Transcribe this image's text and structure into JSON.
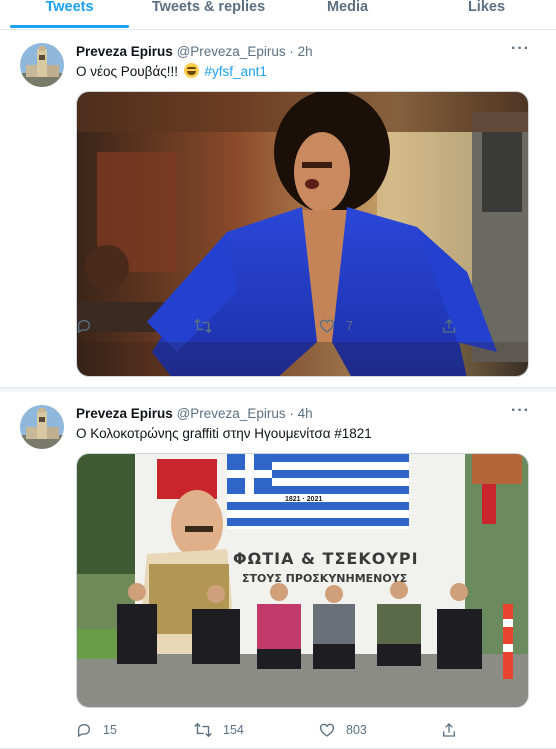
{
  "tabs": [
    {
      "label": "Tweets",
      "active": true
    },
    {
      "label": "Tweets & replies",
      "active": false
    },
    {
      "label": "Media",
      "active": false
    },
    {
      "label": "Likes",
      "active": false
    }
  ],
  "tweets": [
    {
      "name": "Preveza Epirus",
      "handle": "@Preveza_Epirus",
      "dot": "·",
      "time": "2h",
      "text_before": "Ο νέος Ρουβάς!!!",
      "hashtag": "#yfsf_ant1",
      "more": "···",
      "replies": "",
      "retweets": "",
      "likes": "7"
    },
    {
      "name": "Preveza Epirus",
      "handle": "@Preveza_Epirus",
      "dot": "·",
      "time": "4h",
      "text_before": "Ο Κολοκοτρώνης graffiti στην Ηγουμενίτσα #1821",
      "hashtag": "",
      "more": "···",
      "replies": "15",
      "retweets": "154",
      "likes": "803",
      "mural_years": "1821 · 2021",
      "mural_text_1": "ΦΩΤΙΑ & ΤΣΕΚΟΥΡΙ",
      "mural_text_2": "ΣΤΟΥΣ ΠΡΟΣΚΥΝΗΜΕΝΟΥΣ"
    }
  ],
  "icons": {
    "reply": "reply-icon",
    "retweet": "retweet-icon",
    "like": "heart-icon",
    "share": "share-icon",
    "more": "more-icon",
    "emoji": "rolling-on-floor-laughing-emoji"
  },
  "colors": {
    "accent": "#1da1f2",
    "secondary_text": "#5b7083",
    "border": "#e1e8ed"
  }
}
